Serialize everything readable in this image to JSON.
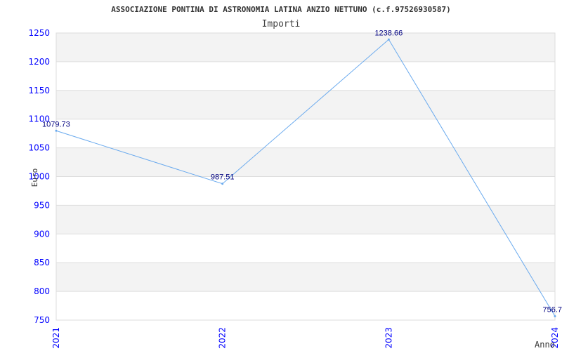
{
  "chart_data": {
    "type": "line",
    "title": "ASSOCIAZIONE PONTINA DI ASTRONOMIA LATINA ANZIO NETTUNO (c.f.97526930587)",
    "subtitle": "Importi",
    "xlabel": "Anno",
    "ylabel": "Euro",
    "categories": [
      "2021",
      "2022",
      "2023",
      "2024"
    ],
    "values": [
      1079.73,
      987.51,
      1238.66,
      756.7
    ],
    "data_labels": [
      "1079.73",
      "987.51",
      "1238.66",
      "756.7"
    ],
    "ylim": [
      750,
      1250
    ],
    "yticks": [
      750,
      800,
      850,
      900,
      950,
      1000,
      1050,
      1100,
      1150,
      1200,
      1250
    ],
    "grid": true,
    "legend": "none",
    "colors": {
      "line": "#6aaaee",
      "tick_labels": "#0000ff",
      "data_labels": "#000080",
      "band": "#f3f3f3",
      "grid": "#dddddd"
    }
  }
}
